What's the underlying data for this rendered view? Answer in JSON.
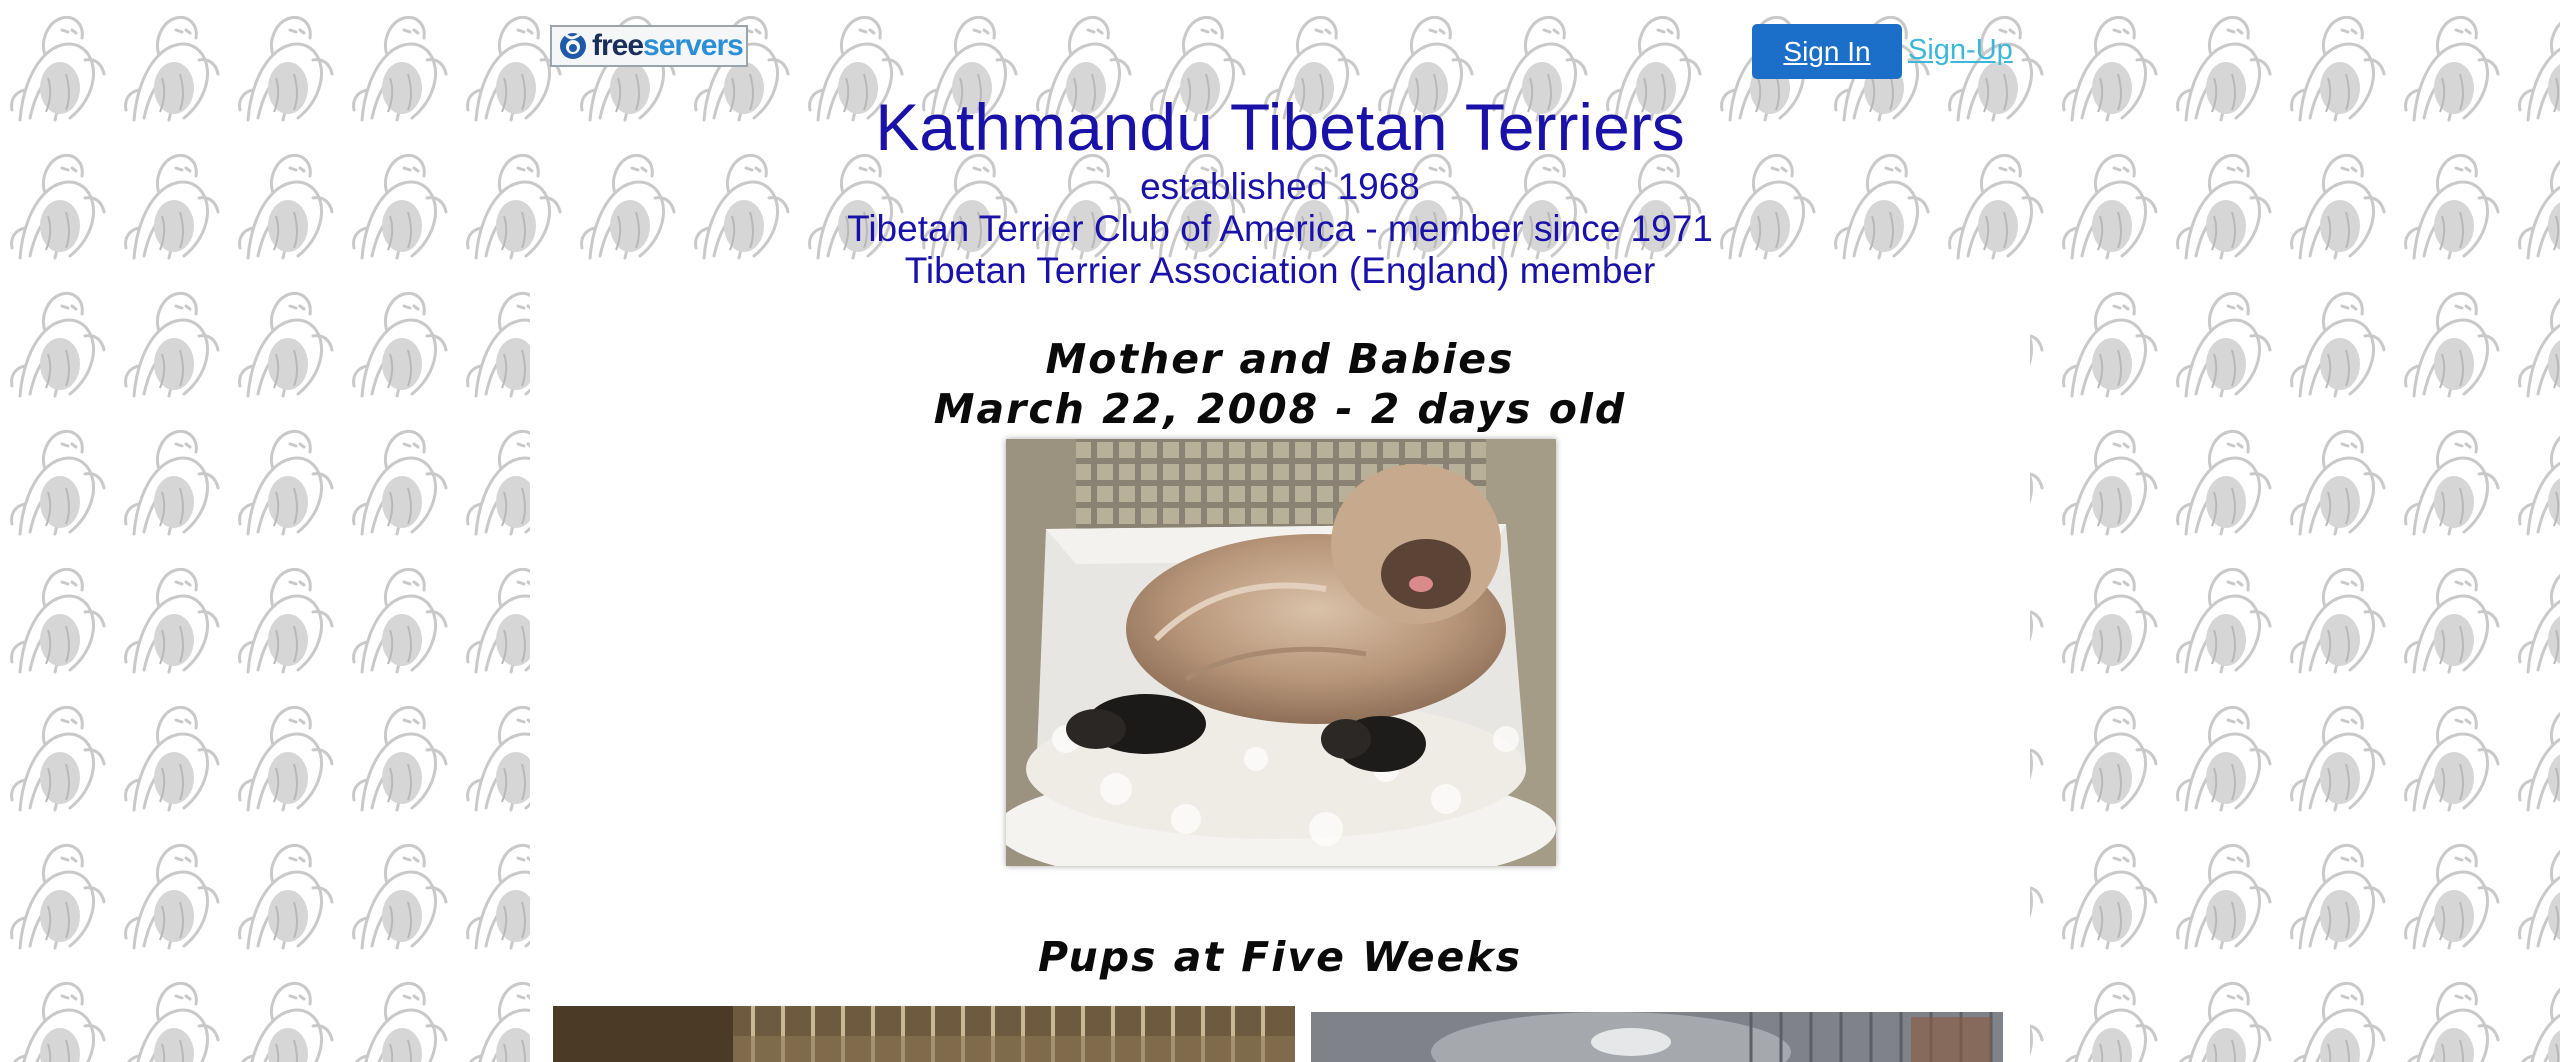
{
  "header": {
    "logo_text_free": "free",
    "logo_text_servers": "servers",
    "signin_label": "Sign In",
    "signup_label": "Sign-Up"
  },
  "site": {
    "title": "Kathmandu Tibetan Terriers",
    "lines": [
      "established 1968",
      "Tibetan Terrier Club of America - member since 1971",
      "Tibetan Terrier Association (England) member"
    ]
  },
  "gallery": {
    "caption_1_line_1": "Mother and Babies",
    "caption_1_line_2": "March 22, 2008 - 2 days old",
    "caption_2": "Pups at Five Weeks"
  },
  "icons": {
    "logo_mark": "freeservers-swirl-icon",
    "background": "dog-sketch-pattern"
  },
  "colors": {
    "title": "#1a12a8",
    "signin_bg": "#1b6fc8",
    "signup_link": "#3db7d9"
  }
}
